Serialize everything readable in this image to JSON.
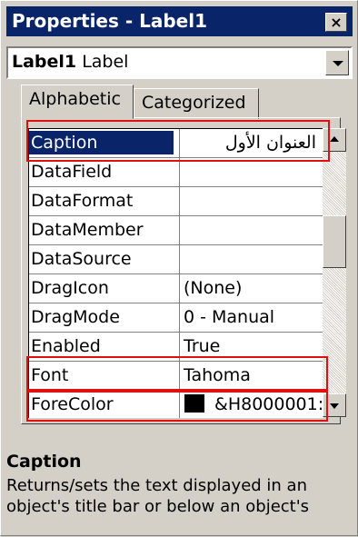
{
  "window": {
    "title": "Properties - Label1",
    "close_glyph": "×"
  },
  "object_combo": {
    "name": "Label1",
    "type": "Label"
  },
  "tabs": [
    {
      "label": "Alphabetic"
    },
    {
      "label": "Categorized"
    }
  ],
  "properties": [
    {
      "name": "Caption",
      "value": "العنوان الأول"
    },
    {
      "name": "DataField",
      "value": ""
    },
    {
      "name": "DataFormat",
      "value": ""
    },
    {
      "name": "DataMember",
      "value": ""
    },
    {
      "name": "DataSource",
      "value": ""
    },
    {
      "name": "DragIcon",
      "value": "(None)"
    },
    {
      "name": "DragMode",
      "value": "0 - Manual"
    },
    {
      "name": "Enabled",
      "value": "True"
    },
    {
      "name": "Font",
      "value": "Tahoma"
    },
    {
      "name": "ForeColor",
      "value": "&H8000001:"
    }
  ],
  "selected_property": "Caption",
  "description": {
    "title": "Caption",
    "text": "Returns/sets the text displayed in an object's title bar or below an object's"
  },
  "colors": {
    "titlebar": "#0a246a",
    "highlight_box": "#e01010",
    "forecolor_swatch": "#000000"
  },
  "icons": {
    "close": "close-icon",
    "combo_dropdown": "chevron-down-icon",
    "scroll_up": "arrow-up-icon",
    "scroll_down": "arrow-down-icon"
  }
}
